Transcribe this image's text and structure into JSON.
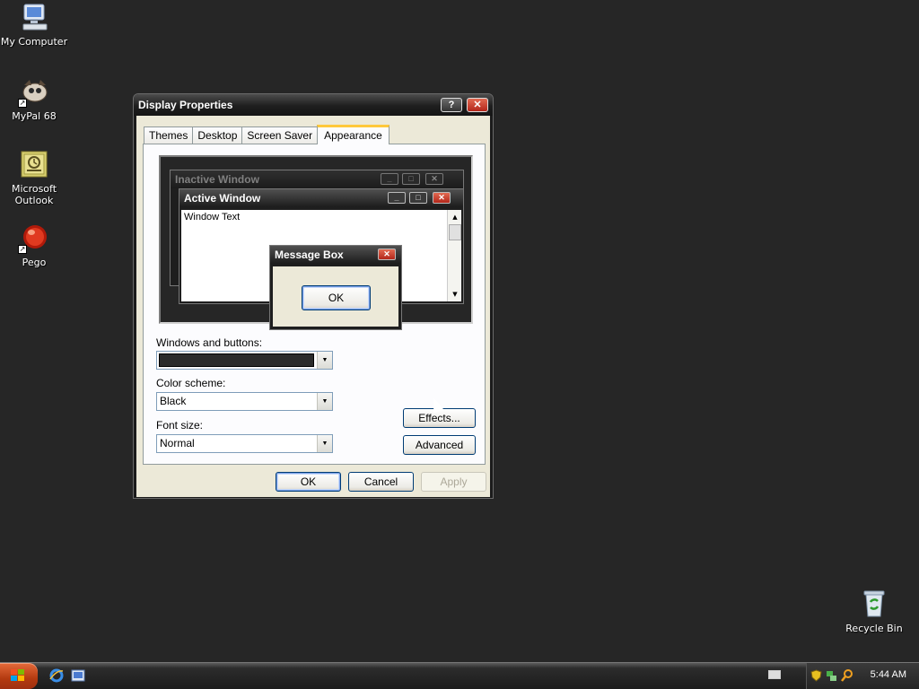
{
  "desktop": {
    "icons": [
      {
        "label": "My Computer"
      },
      {
        "label": "MyPal 68"
      },
      {
        "label": "Microsoft Outlook"
      },
      {
        "label": "Pego"
      },
      {
        "label": "Recycle Bin"
      }
    ]
  },
  "dialog": {
    "title": "Display Properties",
    "help_glyph": "?",
    "close_glyph": "✕",
    "tabs": [
      {
        "label": "Themes"
      },
      {
        "label": "Desktop"
      },
      {
        "label": "Screen Saver"
      },
      {
        "label": "Appearance",
        "active": true
      }
    ],
    "preview": {
      "inactive_title": "Inactive Window",
      "active_title": "Active Window",
      "window_text": "Window Text",
      "message_box_title": "Message Box",
      "ok_label": "OK"
    },
    "windows_and_buttons": {
      "label": "Windows and buttons:",
      "value_color": "#2b2b2b"
    },
    "color_scheme": {
      "label": "Color scheme:",
      "value": "Black"
    },
    "font_size": {
      "label": "Font size:",
      "value": "Normal"
    },
    "effects_label": "Effects...",
    "advanced_label": "Advanced",
    "ok_label": "OK",
    "cancel_label": "Cancel",
    "apply_label": "Apply"
  },
  "taskbar": {
    "clock": "5:44 AM"
  },
  "colors": {
    "desktop": "#262626",
    "start": "#c0461a",
    "tab_highlight": "#ffc83c"
  }
}
